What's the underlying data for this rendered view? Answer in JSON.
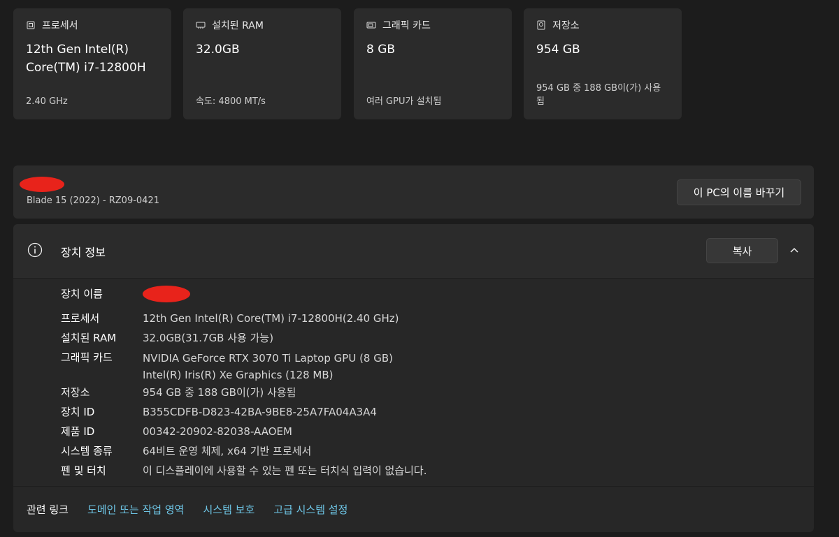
{
  "cards": [
    {
      "icon": "processor-icon",
      "title": "프로세서",
      "value_lines": [
        "12th Gen Intel(R)",
        "Core(TM) i7-12800H"
      ],
      "sub_lines": [
        "2.40 GHz"
      ]
    },
    {
      "icon": "ram-icon",
      "title": "설치된 RAM",
      "value_lines": [
        "32.0GB"
      ],
      "sub_lines": [
        "속도: 4800 MT/s"
      ]
    },
    {
      "icon": "graphics-card-icon",
      "title": "그래픽 카드",
      "value_lines": [
        "8 GB"
      ],
      "sub_lines": [
        "여러 GPU가 설치됨"
      ]
    },
    {
      "icon": "storage-icon",
      "title": "저장소",
      "value_lines": [
        "954 GB"
      ],
      "sub_lines": [
        "954 GB 중 188 GB이(가) 사용",
        "됨"
      ]
    }
  ],
  "device": {
    "model": "Blade 15 (2022) - RZ09-0421",
    "rename_label": "이 PC의 이름 바꾸기"
  },
  "specs": {
    "title": "장치 정보",
    "copy_label": "복사",
    "rows": [
      {
        "key": "장치 이름",
        "values": []
      },
      {
        "key": "프로세서",
        "values": [
          "12th Gen Intel(R) Core(TM) i7-12800H(2.40 GHz)"
        ]
      },
      {
        "key": "설치된 RAM",
        "values": [
          "32.0GB(31.7GB 사용 가능)"
        ]
      },
      {
        "key": "그래픽 카드",
        "values": [
          "NVIDIA GeForce RTX 3070 Ti Laptop GPU (8 GB)",
          "Intel(R) Iris(R) Xe Graphics (128 MB)"
        ]
      },
      {
        "key": "저장소",
        "values": [
          "954 GB 중 188 GB이(가) 사용됨"
        ]
      },
      {
        "key": "장치 ID",
        "values": [
          "B355CDFB-D823-42BA-9BE8-25A7FA04A3A4"
        ]
      },
      {
        "key": "제품 ID",
        "values": [
          "00342-20902-82038-AAOEM"
        ]
      },
      {
        "key": "시스템 종류",
        "values": [
          "64비트 운영 체제, x64 기반 프로세서"
        ]
      },
      {
        "key": "펜 및 터치",
        "values": [
          "이 디스플레이에 사용할 수 있는 펜 또는 터치식 입력이 없습니다."
        ]
      }
    ]
  },
  "related": {
    "label": "관련 링크",
    "links": [
      "도메인 또는 작업 영역",
      "시스템 보호",
      "고급 시스템 설정"
    ]
  },
  "colors": {
    "accent_link": "#6ec6e6",
    "redaction": "#e8231b"
  }
}
